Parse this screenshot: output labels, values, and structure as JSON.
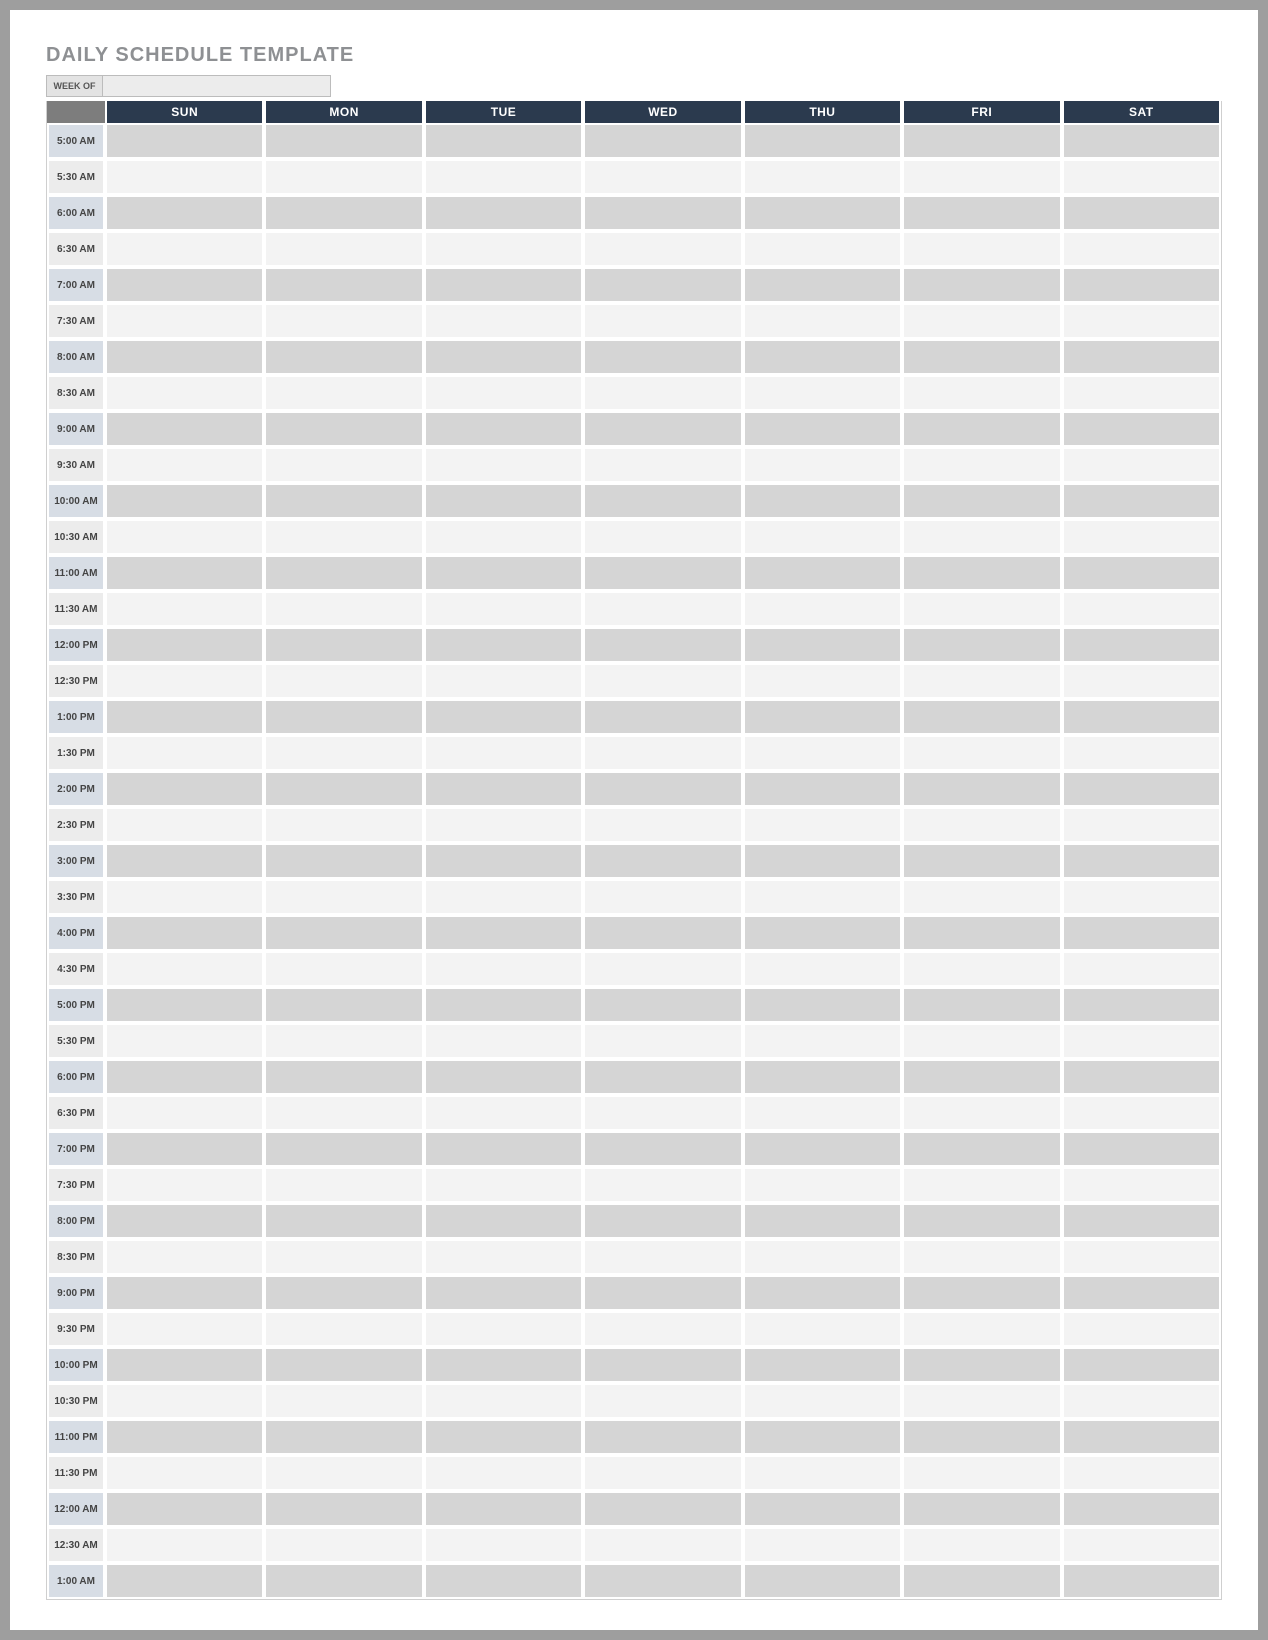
{
  "title": "DAILY SCHEDULE TEMPLATE",
  "weekof": {
    "label": "WEEK OF",
    "value": ""
  },
  "days": [
    "SUN",
    "MON",
    "TUE",
    "WED",
    "THU",
    "FRI",
    "SAT"
  ],
  "times": [
    "5:00 AM",
    "5:30 AM",
    "6:00 AM",
    "6:30 AM",
    "7:00 AM",
    "7:30 AM",
    "8:00 AM",
    "8:30 AM",
    "9:00 AM",
    "9:30 AM",
    "10:00 AM",
    "10:30 AM",
    "11:00 AM",
    "11:30 AM",
    "12:00 PM",
    "12:30 PM",
    "1:00 PM",
    "1:30 PM",
    "2:00 PM",
    "2:30 PM",
    "3:00 PM",
    "3:30 PM",
    "4:00 PM",
    "4:30 PM",
    "5:00 PM",
    "5:30 PM",
    "6:00 PM",
    "6:30 PM",
    "7:00 PM",
    "7:30 PM",
    "8:00 PM",
    "8:30 PM",
    "9:00 PM",
    "9:30 PM",
    "10:00 PM",
    "10:30 PM",
    "11:00 PM",
    "11:30 PM",
    "12:00 AM",
    "12:30 AM",
    "1:00 AM"
  ],
  "cells": {}
}
